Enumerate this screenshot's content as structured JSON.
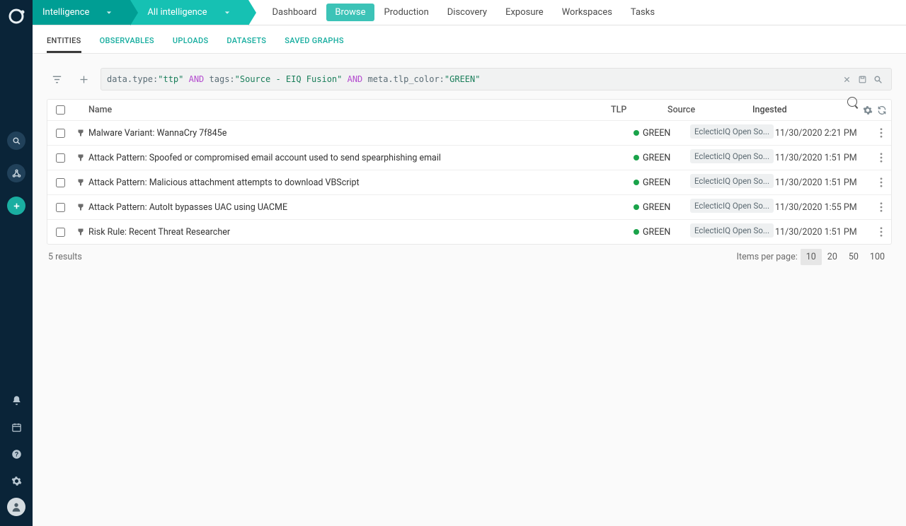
{
  "breadcrumb": {
    "level1": "Intelligence",
    "level2": "All intelligence"
  },
  "topnav": {
    "items": [
      "Dashboard",
      "Browse",
      "Production",
      "Discovery",
      "Exposure",
      "Workspaces",
      "Tasks"
    ],
    "active": "Browse"
  },
  "subtabs": {
    "items": [
      "ENTITIES",
      "OBSERVABLES",
      "UPLOADS",
      "DATASETS",
      "SAVED GRAPHS"
    ],
    "active": "ENTITIES"
  },
  "query": {
    "parts": [
      {
        "t": "key",
        "v": "data.type:"
      },
      {
        "t": "str",
        "v": "\"ttp\""
      },
      {
        "t": "sp",
        "v": " "
      },
      {
        "t": "op",
        "v": "AND"
      },
      {
        "t": "sp",
        "v": " "
      },
      {
        "t": "key",
        "v": "tags:"
      },
      {
        "t": "str",
        "v": "\"Source - EIQ Fusion\""
      },
      {
        "t": "sp",
        "v": " "
      },
      {
        "t": "op",
        "v": "AND"
      },
      {
        "t": "sp",
        "v": " "
      },
      {
        "t": "key",
        "v": "meta.tlp_color:"
      },
      {
        "t": "str",
        "v": "\"GREEN\""
      }
    ]
  },
  "columns": {
    "name": "Name",
    "tlp": "TLP",
    "source": "Source",
    "ingested": "Ingested"
  },
  "rows": [
    {
      "name": "Malware Variant: WannaCry 7f845e",
      "tlp": "GREEN",
      "source": "EclecticIQ Open So...",
      "ingested": "11/30/2020 2:21 PM"
    },
    {
      "name": "Attack Pattern: Spoofed or compromised email account used to send spearphishing email",
      "tlp": "GREEN",
      "source": "EclecticIQ Open So...",
      "ingested": "11/30/2020 1:51 PM"
    },
    {
      "name": "Attack Pattern: Malicious attachment attempts to download VBScript",
      "tlp": "GREEN",
      "source": "EclecticIQ Open So...",
      "ingested": "11/30/2020 1:51 PM"
    },
    {
      "name": "Attack Pattern: AutoIt bypasses UAC using UACME",
      "tlp": "GREEN",
      "source": "EclecticIQ Open So...",
      "ingested": "11/30/2020 1:55 PM"
    },
    {
      "name": "Risk Rule: Recent Threat Researcher",
      "tlp": "GREEN",
      "source": "EclecticIQ Open So...",
      "ingested": "11/30/2020 1:51 PM"
    }
  ],
  "footer": {
    "results": "5 results",
    "items_label": "Items per page:",
    "options": [
      "10",
      "20",
      "50",
      "100"
    ],
    "active": "10"
  },
  "colors": {
    "tlp_green": "#1aa34a"
  }
}
